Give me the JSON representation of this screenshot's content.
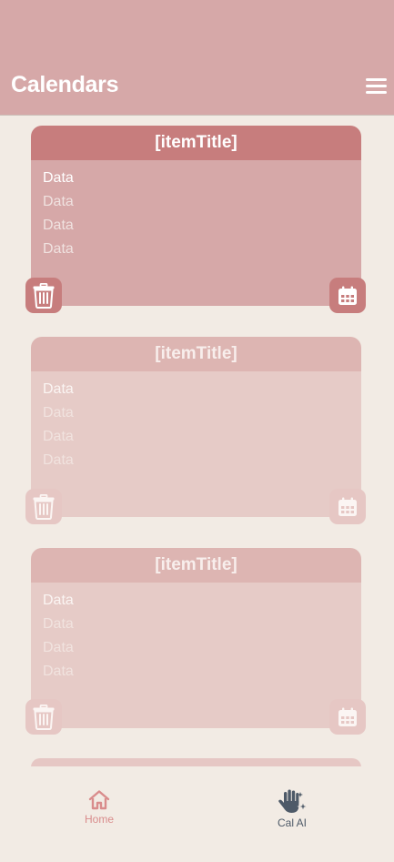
{
  "header": {
    "title": "Calendars",
    "menu_icon": "hamburger-menu-icon"
  },
  "cards": [
    {
      "title": "[itemTitle]",
      "rows": [
        "Data",
        "Data",
        "Data",
        "Data"
      ],
      "state": "active"
    },
    {
      "title": "[itemTitle]",
      "rows": [
        "Data",
        "Data",
        "Data",
        "Data"
      ],
      "state": "dim"
    },
    {
      "title": "[itemTitle]",
      "rows": [
        "Data",
        "Data",
        "Data",
        "Data"
      ],
      "state": "dim"
    }
  ],
  "card_actions": {
    "delete_icon": "trash-icon",
    "calendar_icon": "calendar-icon"
  },
  "nav": {
    "items": [
      {
        "label": "Home",
        "icon": "home-icon",
        "color": "#d98c8c"
      },
      {
        "label": "Cal AI",
        "icon": "ai-hand-sparkle-icon",
        "color": "#4e5a68"
      }
    ]
  },
  "colors": {
    "appbar": "#d6a8a8",
    "background": "#f2ebe4",
    "accent": "#c77d7d",
    "card_dim": "#e6cbc7"
  }
}
